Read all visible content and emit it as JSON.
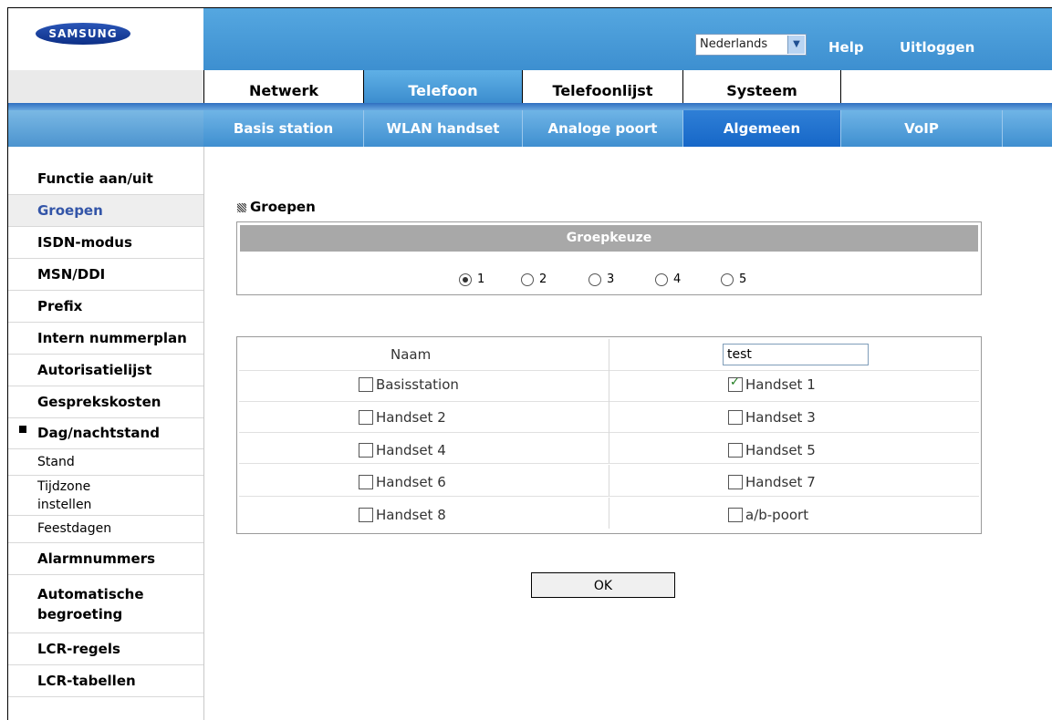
{
  "brand": {
    "logo": "SAMSUNG"
  },
  "header": {
    "language": "Nederlands",
    "help": "Help",
    "logout": "Uitloggen"
  },
  "main_tabs": [
    {
      "label": "Netwerk"
    },
    {
      "label": "Telefoon"
    },
    {
      "label": "Telefoonlijst"
    },
    {
      "label": "Systeem"
    }
  ],
  "active_main_tab": "Telefoon",
  "sub_tabs": [
    {
      "label": "Basis station"
    },
    {
      "label": "WLAN handset"
    },
    {
      "label": "Analoge poort"
    },
    {
      "label": "Algemeen"
    },
    {
      "label": "VoIP"
    }
  ],
  "active_sub_tab": "Algemeen",
  "sidebar": {
    "items": [
      {
        "label": "Functie aan/uit"
      },
      {
        "label": "Groepen"
      },
      {
        "label": "ISDN-modus"
      },
      {
        "label": "MSN/DDI"
      },
      {
        "label": "Prefix"
      },
      {
        "label": "Intern nummerplan"
      },
      {
        "label": "Autorisatielijst"
      },
      {
        "label": "Gesprekskosten"
      },
      {
        "label": "Dag/nachtstand"
      },
      {
        "label": "Stand"
      },
      {
        "label": "Tijdzone instellen"
      },
      {
        "label": "Feestdagen"
      },
      {
        "label": "Alarmnummers"
      },
      {
        "label": "Automatische begroeting"
      },
      {
        "label": "LCR-regels"
      },
      {
        "label": "LCR-tabellen"
      }
    ],
    "selected": "Groepen"
  },
  "content": {
    "title": "Groepen",
    "group_header": "Groepkeuze",
    "radios": [
      "1",
      "2",
      "3",
      "4",
      "5"
    ],
    "selected_group": "1",
    "name_label": "Naam",
    "name_value": "test",
    "checkboxes": [
      {
        "label": "Basisstation",
        "checked": false
      },
      {
        "label": "Handset 1",
        "checked": true
      },
      {
        "label": "Handset 2",
        "checked": false
      },
      {
        "label": "Handset 3",
        "checked": false
      },
      {
        "label": "Handset 4",
        "checked": false
      },
      {
        "label": "Handset 5",
        "checked": false
      },
      {
        "label": "Handset 6",
        "checked": false
      },
      {
        "label": "Handset 7",
        "checked": false
      },
      {
        "label": "Handset 8",
        "checked": false
      },
      {
        "label": "a/b-poort",
        "checked": false
      }
    ],
    "ok": "OK"
  },
  "colors": {
    "header_blue": "#4a9bd8",
    "active_tab": "#3a8bcd",
    "selected_sidebar_text": "#3355a8"
  }
}
